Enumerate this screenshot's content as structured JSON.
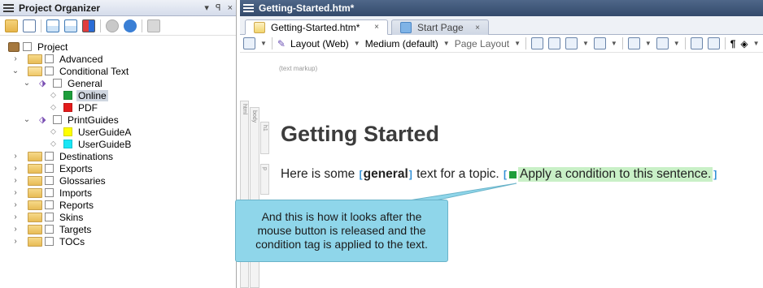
{
  "left_pane": {
    "title": "Project Organizer",
    "controls": {
      "dropdown": "▾",
      "pin": "ꟼ",
      "close": "×"
    },
    "tree": [
      {
        "label": "Project",
        "icon": "project-bag-icon",
        "depth": 0,
        "expander": ""
      },
      {
        "label": "Advanced",
        "icon": "folder-icon",
        "depth": 1,
        "expander": "›"
      },
      {
        "label": "Conditional Text",
        "icon": "folder-open-icon",
        "depth": 1,
        "expander": "⌄"
      },
      {
        "label": "General",
        "icon": "condition-tags-icon",
        "depth": 2,
        "expander": "⌄"
      },
      {
        "label": "Online",
        "icon": "tag-icon",
        "depth": 3,
        "swatch": "#1e9e3b",
        "selected": true
      },
      {
        "label": "PDF",
        "icon": "tag-icon",
        "depth": 3,
        "swatch": "#e31b1b"
      },
      {
        "label": "PrintGuides",
        "icon": "condition-tags-icon",
        "depth": 2,
        "expander": "⌄"
      },
      {
        "label": "UserGuideA",
        "icon": "tag-icon",
        "depth": 3,
        "swatch": "#ffff00"
      },
      {
        "label": "UserGuideB",
        "icon": "tag-icon",
        "depth": 3,
        "swatch": "#19e6f5"
      },
      {
        "label": "Destinations",
        "icon": "folder-icon",
        "depth": 1,
        "expander": "›"
      },
      {
        "label": "Exports",
        "icon": "folder-icon",
        "depth": 1,
        "expander": "›"
      },
      {
        "label": "Glossaries",
        "icon": "folder-icon",
        "depth": 1,
        "expander": "›"
      },
      {
        "label": "Imports",
        "icon": "folder-icon",
        "depth": 1,
        "expander": "›"
      },
      {
        "label": "Reports",
        "icon": "folder-icon",
        "depth": 1,
        "expander": "›"
      },
      {
        "label": "Skins",
        "icon": "folder-icon",
        "depth": 1,
        "expander": "›"
      },
      {
        "label": "Targets",
        "icon": "folder-icon",
        "depth": 1,
        "expander": "›"
      },
      {
        "label": "TOCs",
        "icon": "folder-icon",
        "depth": 1,
        "expander": "›"
      }
    ]
  },
  "editor": {
    "title": "Getting-Started.htm*",
    "tabs": [
      {
        "label": "Getting-Started.htm*",
        "close": "×",
        "active": true
      },
      {
        "label": "Start Page",
        "close": "×",
        "active": false
      }
    ],
    "toolbar": {
      "layout": "Layout (Web)",
      "medium": "Medium (default)",
      "page_layout": "Page Layout"
    },
    "markup_note": "(text markup)",
    "structure_labels": {
      "html": "html",
      "body": "body",
      "h1": "h1",
      "p": "p"
    },
    "heading": "Getting Started",
    "paragraph": {
      "before": "Here is some ",
      "bold_word": "general",
      "middle": " text for a topic. ",
      "conditioned": "Apply a condition to this sentence."
    },
    "condition_color": "#1e9e3b",
    "highlight_color": "#c9f0c7"
  },
  "callout": {
    "text": "And this is how it looks after the mouse button is released and the condition tag is applied to the text.",
    "color": "#8fd6ea"
  }
}
